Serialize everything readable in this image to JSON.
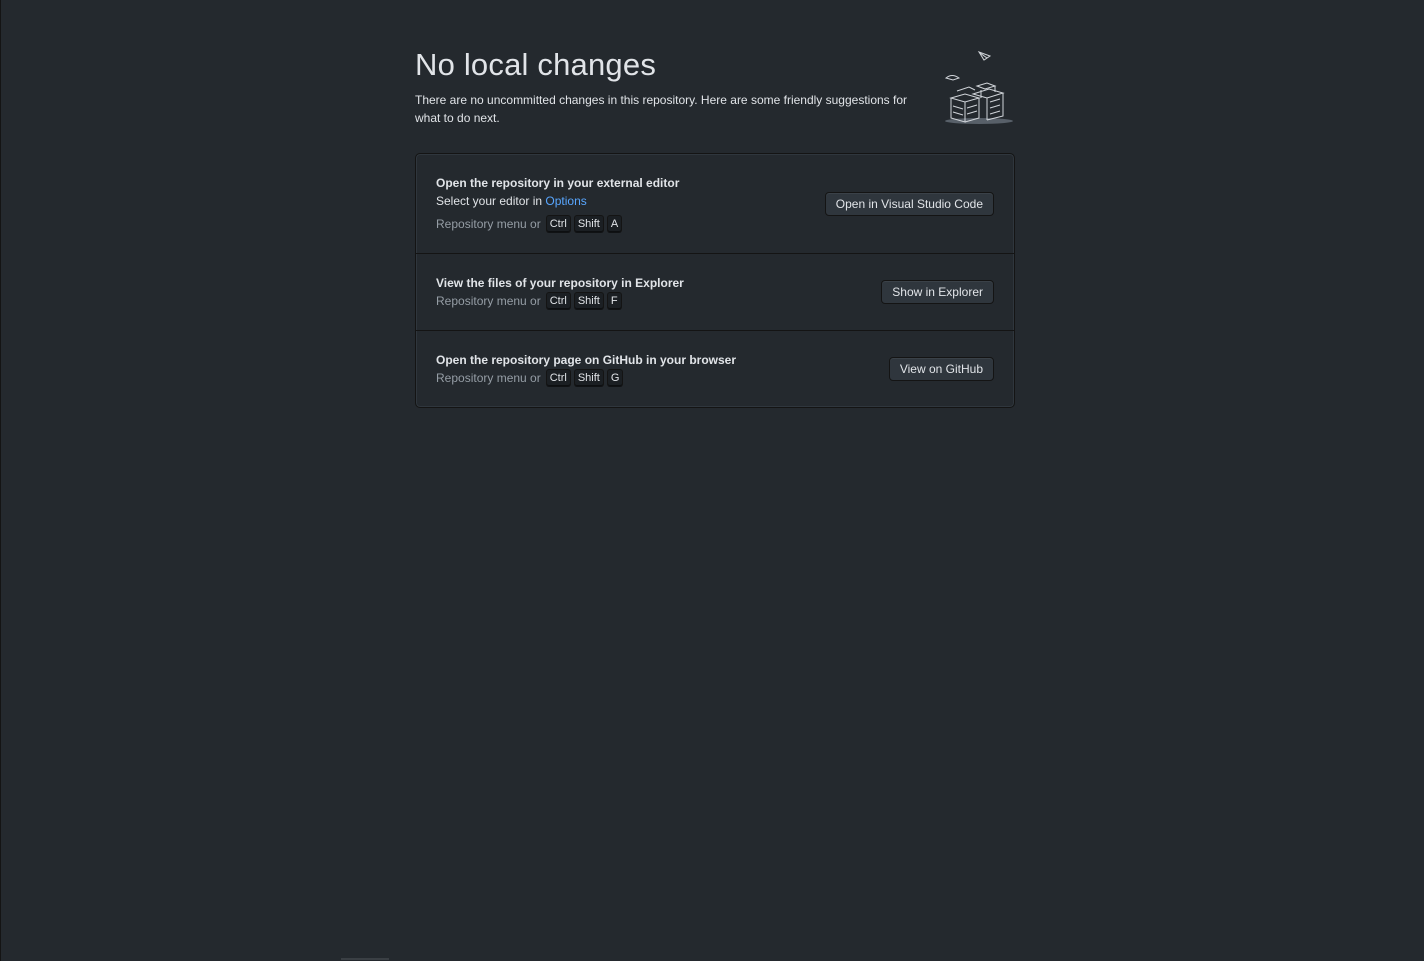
{
  "header": {
    "title": "No local changes",
    "subtitle": "There are no uncommitted changes in this repository. Here are some friendly suggestions for what to do next."
  },
  "suggestions": [
    {
      "title": "Open the repository in your external editor",
      "description_prefix": "Select your editor in ",
      "description_link": "Options",
      "hint_label": "Repository menu or",
      "keys": [
        "Ctrl",
        "Shift",
        "A"
      ],
      "button": "Open in Visual Studio Code"
    },
    {
      "title": "View the files of your repository in Explorer",
      "hint_label": "Repository menu or",
      "keys": [
        "Ctrl",
        "Shift",
        "F"
      ],
      "button": "Show in Explorer"
    },
    {
      "title": "Open the repository page on GitHub in your browser",
      "hint_label": "Repository menu or",
      "keys": [
        "Ctrl",
        "Shift",
        "G"
      ],
      "button": "View on GitHub"
    }
  ],
  "icons": {
    "illustration": "empty-repository-illustration-icon"
  },
  "colors": {
    "background": "#24292e",
    "link": "#58a6ff",
    "text": "#e1e4e8",
    "muted": "#959da5"
  }
}
